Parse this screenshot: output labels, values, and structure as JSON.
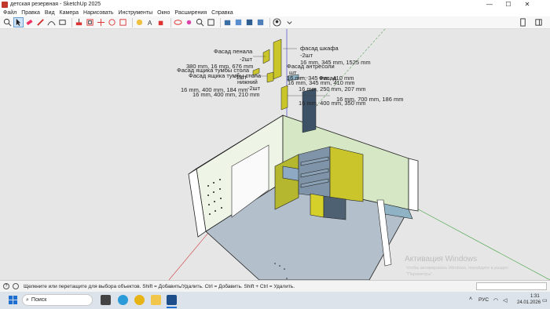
{
  "window": {
    "title": "детская резервная - SketchUp 2025"
  },
  "menu": [
    "Файл",
    "Правка",
    "Вид",
    "Камера",
    "Нарисовать",
    "Инструменты",
    "Окно",
    "Расширения",
    "Справка"
  ],
  "labels": {
    "pencil_facade": "Фасад пенала",
    "pencil_count": "-2шт",
    "pencil_size": "380 mm, 16 mm, 676 mm",
    "drawer_tube": "Фасад ящика тумбы стола",
    "drawer_bottom": "Фасад ящика тумбы стола",
    "bottom": "нижний",
    "count_1": "-1шт",
    "count_2": "-2шт",
    "size_184": "16 mm, 400 mm, 184 mm",
    "size_210": "16 mm, 400 mm, 210 mm",
    "wardrobe_facade": "фасад шкафа",
    "wardrobe_count": "-2шт",
    "wardrobe_size": "16 mm, 345 mm, 1525 mm",
    "mezz_facade": "Фасад антресоли",
    "mezz_count": "шт",
    "mezz_size": "16 mm, 345 mm, 410 mm",
    "facade_short": "Фасад",
    "size_410": "16 mm, 345 mm, 410 mm",
    "size_207": "16 mm, 250 mm, 207 mm",
    "size_350": "16 mm, 400 mm, 350 mm",
    "size_186": "16 mm, 700 mm, 186 mm"
  },
  "status": {
    "text": "Щелкните или перетащите для выбора объектов. Shift = Добавить/Удалить. Ctrl = Добавить. Shift + Ctrl = Удалить."
  },
  "watermark": {
    "line1": "Активация Windows",
    "line2": "Чтобы активировать Windows, перейдите в раздел",
    "line3": "\"Параметры\"."
  },
  "taskbar": {
    "search_placeholder": "Поиск",
    "lang": "РУС",
    "time": "1:31",
    "date": "24.01.2026"
  }
}
